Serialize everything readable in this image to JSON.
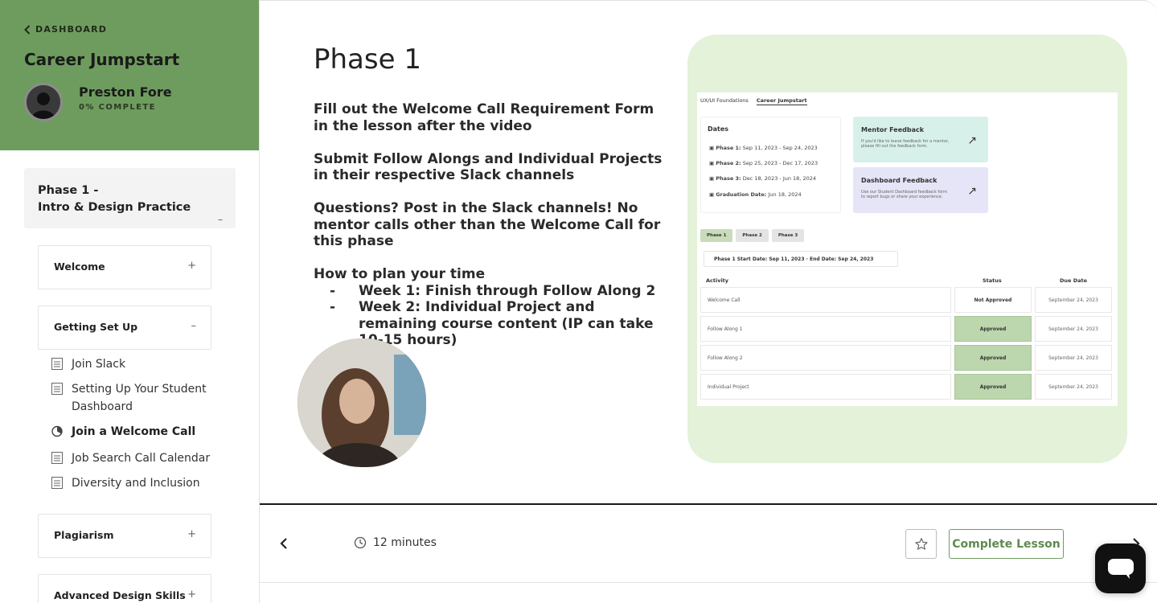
{
  "sidebar": {
    "back_label": "DASHBOARD",
    "course_title": "Career Jumpstart",
    "student_name": "Preston Fore",
    "student_progress": "0% COMPLETE",
    "phase": {
      "title_line1": "Phase 1 -",
      "title_line2": "Intro & Design Practice",
      "toggle": "–"
    },
    "sections": [
      {
        "label": "Welcome",
        "toggle": "+"
      },
      {
        "label": "Getting Set Up",
        "toggle": "–"
      },
      {
        "label": "Plagiarism",
        "toggle": "+"
      },
      {
        "label": "Advanced Design Skills",
        "toggle": "+"
      }
    ],
    "lessons": [
      {
        "label": "Join Slack",
        "icon": "document-icon"
      },
      {
        "label": "Setting Up Your Student Dashboard",
        "icon": "document-icon"
      },
      {
        "label": "Join a Welcome Call",
        "icon": "in-progress-icon"
      },
      {
        "label": "Job Search Call Calendar",
        "icon": "document-icon"
      },
      {
        "label": "Diversity and Inclusion",
        "icon": "document-icon"
      }
    ]
  },
  "slide": {
    "heading": "Phase 1",
    "paragraphs": [
      "Fill out the Welcome Call Requirement Form in the lesson after the video",
      "Submit Follow Alongs and Individual Projects in their respective Slack channels",
      "Questions? Post in the Slack channels! No mentor calls other than the Welcome Call for this phase"
    ],
    "plan_heading": "How to plan your time",
    "plan_bullet": "-",
    "plan_items": [
      "Week 1: Finish through Follow Along 2",
      "Week 2: Individual Project and remaining course content (IP can take 10-15 hours)"
    ],
    "mockup": {
      "tabs": [
        "UX/UI Foundations",
        "Career Jumpstart"
      ],
      "dates_heading": "Dates",
      "dates": [
        {
          "label": "Phase 1:",
          "value": "Sep 11, 2023 - Sep 24, 2023"
        },
        {
          "label": "Phase 2:",
          "value": "Sep 25, 2023 - Dec 17, 2023"
        },
        {
          "label": "Phase 3:",
          "value": "Dec 18, 2023 - Jun 18, 2024"
        },
        {
          "label": "Graduation Date:",
          "value": "Jun 18, 2024"
        }
      ],
      "mentor_card": {
        "title": "Mentor Feedback",
        "desc": "If you'd like to leave feedback for a mentor, please fill out the feedback form."
      },
      "dashboard_card": {
        "title": "Dashboard Feedback",
        "desc": "Use our Student Dashboard feedback form to report bugs or share your experience."
      },
      "phase_tabs": [
        "Phase 1",
        "Phase 2",
        "Phase 3"
      ],
      "range": "Phase 1 Start Date: Sep 11, 2023  ·  End Date: Sep 24, 2023",
      "headers": {
        "activity": "Activity",
        "status": "Status",
        "due": "Due Date"
      },
      "rows": [
        {
          "activity": "Welcome Call",
          "status": "Not Approved",
          "due": "September 24, 2023"
        },
        {
          "activity": "Follow Along 1",
          "status": "Approved",
          "due": "September 24, 2023"
        },
        {
          "activity": "Follow Along 2",
          "status": "Approved",
          "due": "September 24, 2023"
        },
        {
          "activity": "Individual Project",
          "status": "Approved",
          "due": "September 24, 2023"
        }
      ]
    }
  },
  "bottom": {
    "duration": "12 minutes",
    "complete_label": "Complete Lesson"
  },
  "colors": {
    "brand_green": "#6e9c5e",
    "mockup_bg": "#e3f2d9",
    "approved": "#bcd6ad"
  }
}
